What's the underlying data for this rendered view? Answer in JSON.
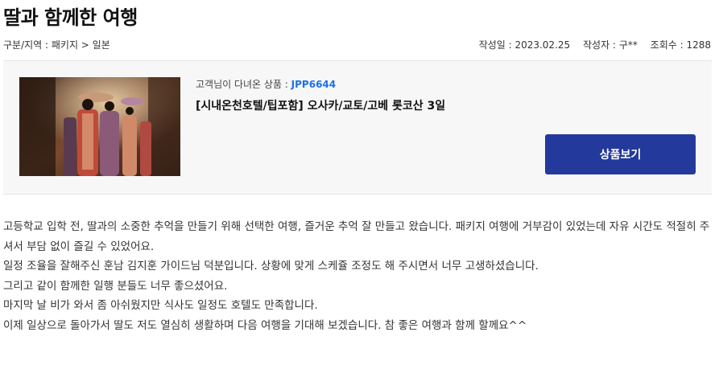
{
  "post": {
    "title": "딸과 함께한 여행",
    "category_label": "구분/지역 : 패키지 > 일본",
    "date_label": "작성일 : 2023.02.25",
    "author_label": "작성자 : 구**",
    "views_label": "조회수 : 1288"
  },
  "product": {
    "code_prefix": "고객님이 다녀온 상품 : ",
    "code": "JPP6644",
    "name": "[시내온천호텔/팁포함] 오사카/교토/고베 롯코산 3일",
    "button_label": "상품보기",
    "image_alt": "kimono-street-photo"
  },
  "review": {
    "paragraphs": [
      "고등학교 입학 전, 딸과의 소중한 추억을 만들기 위해 선택한 여행, 즐거운 추억 잘 만들고 왔습니다. 패키지 여행에 거부감이 있었는데 자유 시간도 적절히 주셔서 부담 없이 즐길 수 있었어요.",
      "일정 조율을 잘해주신 훈남 김지훈 가이드님 덕분입니다. 상황에 맞게 스케쥴 조정도 해 주시면서 너무 고생하셨습니다.",
      "그리고 같이 함께한 일행 분들도 너무 좋으셨어요.",
      "마지막 날 비가 와서 좀 아쉬웠지만 식사도 일정도 호텔도 만족합니다.",
      "이제 일상으로 돌아가서 딸도 저도 열심히 생활하며 다음 여행을 기대해 보겠습니다. 참 좋은 여행과 함께 할께요^^"
    ]
  },
  "colors": {
    "accent": "#23399c",
    "code_blue": "#1a73e8",
    "box_bg": "#f7f7f8"
  }
}
